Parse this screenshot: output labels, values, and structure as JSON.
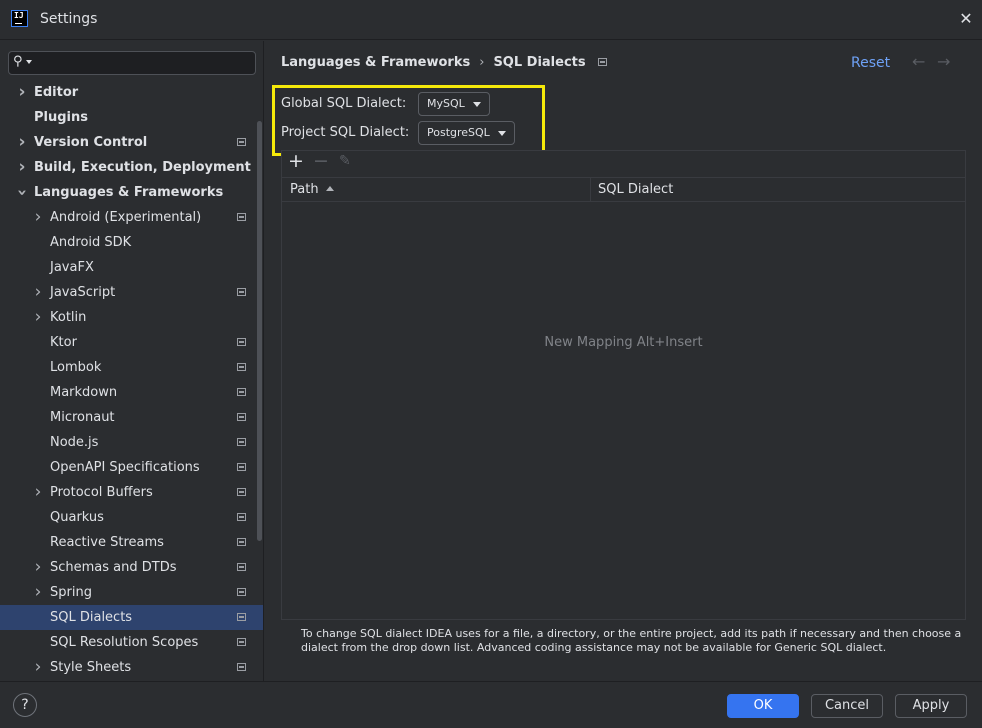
{
  "window": {
    "title": "Settings",
    "app_icon_text": "IJ"
  },
  "sidebar": {
    "search_placeholder": "",
    "items": [
      {
        "label": "Editor",
        "depth": 0,
        "bold": true,
        "expander": "right",
        "project": false
      },
      {
        "label": "Plugins",
        "depth": 0,
        "bold": true,
        "expander": "none",
        "project": false
      },
      {
        "label": "Version Control",
        "depth": 0,
        "bold": true,
        "expander": "right",
        "project": true
      },
      {
        "label": "Build, Execution, Deployment",
        "depth": 0,
        "bold": true,
        "expander": "right",
        "project": false
      },
      {
        "label": "Languages & Frameworks",
        "depth": 0,
        "bold": true,
        "expander": "down",
        "project": false
      },
      {
        "label": "Android (Experimental)",
        "depth": 1,
        "bold": false,
        "expander": "right",
        "project": true
      },
      {
        "label": "Android SDK",
        "depth": 1,
        "bold": false,
        "expander": "none",
        "project": false
      },
      {
        "label": "JavaFX",
        "depth": 1,
        "bold": false,
        "expander": "none",
        "project": false
      },
      {
        "label": "JavaScript",
        "depth": 1,
        "bold": false,
        "expander": "right",
        "project": true
      },
      {
        "label": "Kotlin",
        "depth": 1,
        "bold": false,
        "expander": "right",
        "project": false
      },
      {
        "label": "Ktor",
        "depth": 1,
        "bold": false,
        "expander": "none",
        "project": true
      },
      {
        "label": "Lombok",
        "depth": 1,
        "bold": false,
        "expander": "none",
        "project": true
      },
      {
        "label": "Markdown",
        "depth": 1,
        "bold": false,
        "expander": "none",
        "project": true
      },
      {
        "label": "Micronaut",
        "depth": 1,
        "bold": false,
        "expander": "none",
        "project": true
      },
      {
        "label": "Node.js",
        "depth": 1,
        "bold": false,
        "expander": "none",
        "project": true
      },
      {
        "label": "OpenAPI Specifications",
        "depth": 1,
        "bold": false,
        "expander": "none",
        "project": true
      },
      {
        "label": "Protocol Buffers",
        "depth": 1,
        "bold": false,
        "expander": "right",
        "project": true
      },
      {
        "label": "Quarkus",
        "depth": 1,
        "bold": false,
        "expander": "none",
        "project": true
      },
      {
        "label": "Reactive Streams",
        "depth": 1,
        "bold": false,
        "expander": "none",
        "project": true
      },
      {
        "label": "Schemas and DTDs",
        "depth": 1,
        "bold": false,
        "expander": "right",
        "project": true
      },
      {
        "label": "Spring",
        "depth": 1,
        "bold": false,
        "expander": "right",
        "project": true
      },
      {
        "label": "SQL Dialects",
        "depth": 1,
        "bold": false,
        "expander": "none",
        "project": true,
        "selected": true
      },
      {
        "label": "SQL Resolution Scopes",
        "depth": 1,
        "bold": false,
        "expander": "none",
        "project": true
      },
      {
        "label": "Style Sheets",
        "depth": 1,
        "bold": false,
        "expander": "right",
        "project": true
      }
    ]
  },
  "main": {
    "breadcrumb": [
      "Languages & Frameworks",
      "SQL Dialects"
    ],
    "breadcrumb_separator": "›",
    "reset_label": "Reset",
    "global_dialect": {
      "label": "Global SQL Dialect:",
      "value": "MySQL"
    },
    "project_dialect": {
      "label": "Project SQL Dialect:",
      "value": "PostgreSQL"
    },
    "table": {
      "columns": [
        "Path",
        "SQL Dialect"
      ],
      "empty_text": "New Mapping Alt+Insert"
    },
    "note": "To change SQL dialect IDEA uses for a file, a directory, or the entire project, add its path if necessary and then choose a dialect from the drop down list. Advanced coding assistance may not be available for Generic SQL dialect."
  },
  "footer": {
    "help": "?",
    "ok": "OK",
    "cancel": "Cancel",
    "apply": "Apply"
  },
  "colors": {
    "background": "#2b2d30",
    "accent": "#3574f0",
    "link": "#6ea1f5",
    "selection": "#2e436e",
    "highlight_box": "#f5e90a"
  }
}
